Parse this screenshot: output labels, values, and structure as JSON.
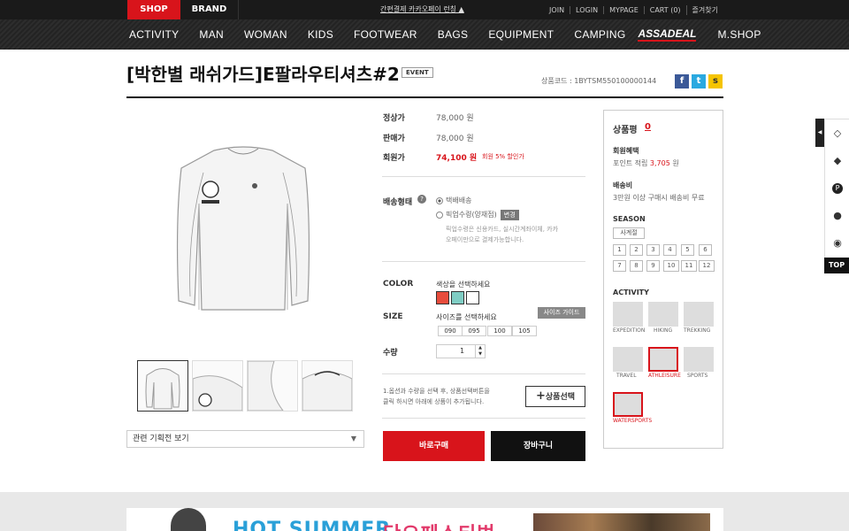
{
  "topbar": {
    "shop_tab": "SHOP",
    "brand_tab": "BRAND",
    "notice": "간편결제 카카오페이 런칭 ▲",
    "links": [
      "JOIN",
      "LOGIN",
      "MYPAGE",
      "CART (0)",
      "즐겨찾기"
    ]
  },
  "nav": {
    "items": [
      "ACTIVITY",
      "MAN",
      "WOMAN",
      "KIDS",
      "FOOTWEAR",
      "BAGS",
      "EQUIPMENT",
      "CAMPING"
    ],
    "logo": "ASSADEAL",
    "mshop": "M.SHOP"
  },
  "product": {
    "title": "[박한별 래쉬가드]E팔라우티셔츠#2",
    "event_badge": "EVENT",
    "code": "상품코드 : 1BYTSM550100000144",
    "regular_label": "정상가",
    "regular_price": "78,000 원",
    "sale_label": "판매가",
    "sale_price": "78,000 원",
    "member_label": "회원가",
    "member_price": "74,100 원",
    "member_discount": "회원 5% 할인가",
    "shipping_label": "배송형태",
    "shipping_opt1": "택배배송",
    "shipping_opt2": "픽업수령(양재점)",
    "change": "변경",
    "pickup_note1": "픽업수령은 신용카드, 실시간계좌이체, 카카",
    "pickup_note2": "오페이만으로 결제가능합니다.",
    "color_label": "COLOR",
    "color_placeholder": "색상을 선택하세요",
    "size_label": "SIZE",
    "size_placeholder": "사이즈를 선택하세요",
    "size_guide": "사이즈 가이드",
    "sizes": [
      "090",
      "095",
      "100",
      "105"
    ],
    "qty_label": "수량",
    "qty": "1",
    "select_note1": "1.옵션과 수량을 선택 후, 상품선택버튼을",
    "select_note2": "클릭 하시면 아래에 상품이 추가됩니다.",
    "select_btn": "상품선택",
    "buy_now": "바로구매",
    "cart": "장바구니",
    "related": "관련 기획전 보기"
  },
  "colors": {
    "accent": "#d8141b",
    "swatch1": "#e74c3c",
    "swatch2": "#7fcdc4",
    "swatch3": "#ffffff"
  },
  "panel": {
    "review_label": "상품평",
    "review_count": "0",
    "benefit_label": "회원혜택",
    "benefit_text_pre": "포인트 적립",
    "benefit_points": "3,705",
    "benefit_unit": "원",
    "ship_label": "배송비",
    "ship_text": "3만원 이상 구매시 배송비 무료",
    "season_label": "SEASON",
    "season_all": "사계절",
    "months": [
      "1",
      "2",
      "3",
      "4",
      "5",
      "6",
      "7",
      "8",
      "9",
      "10",
      "11",
      "12"
    ],
    "activity_label": "ACTIVITY",
    "activities": [
      "EXPEDITION",
      "HIKING",
      "TREKKING",
      "TRAVEL",
      "ATHLEISURE",
      "SPORTS",
      "WATERSPORTS"
    ]
  },
  "side": {
    "top": "TOP",
    "icons": [
      "diamond-icon",
      "tag-icon",
      "p-coin-icon",
      "location-icon",
      "eye-icon"
    ]
  },
  "banner": {
    "text1": "HOT SUMMER",
    "text2": "단오페스티벌"
  }
}
